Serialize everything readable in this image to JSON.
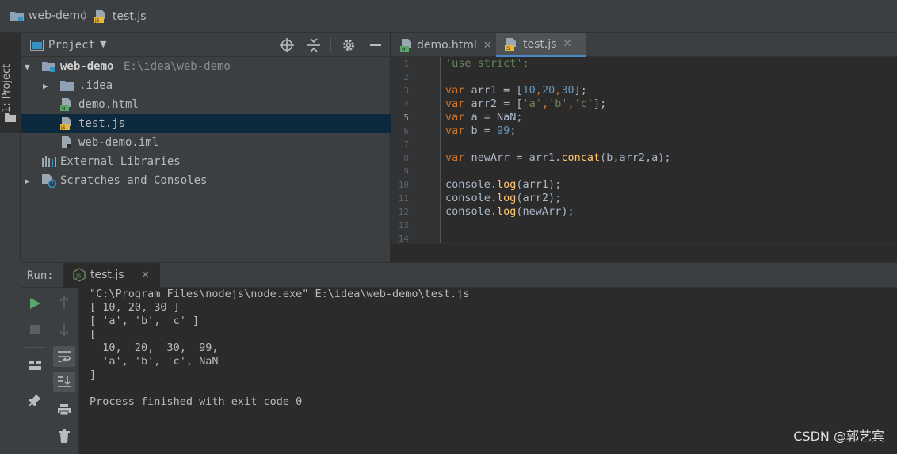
{
  "navbar": {
    "project": "web-demo",
    "file": "test.js"
  },
  "stripe": {
    "label": "1: Project"
  },
  "project_panel": {
    "title": "Project",
    "tree": [
      {
        "name": "web-demo",
        "path": "E:\\idea\\web-demo",
        "kind": "module"
      },
      {
        "name": ".idea",
        "kind": "folder"
      },
      {
        "name": "demo.html",
        "kind": "html"
      },
      {
        "name": "test.js",
        "kind": "js",
        "selected": true
      },
      {
        "name": "web-demo.iml",
        "kind": "iml"
      },
      {
        "name": "External Libraries",
        "kind": "libraries"
      },
      {
        "name": "Scratches and Consoles",
        "kind": "scratches"
      }
    ]
  },
  "editor": {
    "tabs": [
      {
        "label": "demo.html",
        "active": false
      },
      {
        "label": "test.js",
        "active": true
      }
    ],
    "line_numbers": [
      "1",
      "2",
      "3",
      "4",
      "5",
      "6",
      "7",
      "8",
      "9",
      "10",
      "11",
      "12",
      "13",
      "14"
    ],
    "current_line": "5",
    "code": {
      "l1": "'use strict';",
      "l3_kw": "var",
      "l3_rest_a": " arr1 = [",
      "l3_n1": "10",
      "l3_n2": "20",
      "l3_n3": "30",
      "l3_end": "];",
      "l4_kw": "var",
      "l4_rest_a": " arr2 = [",
      "l4_s1": "'a'",
      "l4_s2": "'b'",
      "l4_s3": "'c'",
      "l4_end": "];",
      "l5_kw": "var",
      "l5_rest": " a = NaN;",
      "l6_kw": "var",
      "l6_rest": " b = ",
      "l6_num": "99",
      "l6_end": ";",
      "l8_kw": "var",
      "l8_rest": " newArr = arr1.",
      "l8_fn": "concat",
      "l8_args": "(b,arr2,a);",
      "l10_obj": "console.",
      "l10_fn": "log",
      "l10_args": "(arr1);",
      "l11_obj": "console.",
      "l11_fn": "log",
      "l11_args": "(arr2);",
      "l12_obj": "console.",
      "l12_fn": "log",
      "l12_args": "(newArr);"
    }
  },
  "run_panel": {
    "label": "Run:",
    "tab": "test.js",
    "output": [
      "\"C:\\Program Files\\nodejs\\node.exe\" E:\\idea\\web-demo\\test.js",
      "[ 10, 20, 30 ]",
      "[ 'a', 'b', 'c' ]",
      "[",
      "  10,  20,  30,  99,",
      "  'a', 'b', 'c', NaN",
      "]",
      "",
      "Process finished with exit code 0"
    ]
  },
  "watermark": "CSDN @郭艺宾",
  "colors": {
    "background": "#2b2b2b",
    "panel": "#3c3f41",
    "selection": "#0d293e",
    "keyword": "#cc7832",
    "string": "#6a8759",
    "number": "#6897bb",
    "function": "#ffc66d",
    "run_green": "#59a869"
  }
}
